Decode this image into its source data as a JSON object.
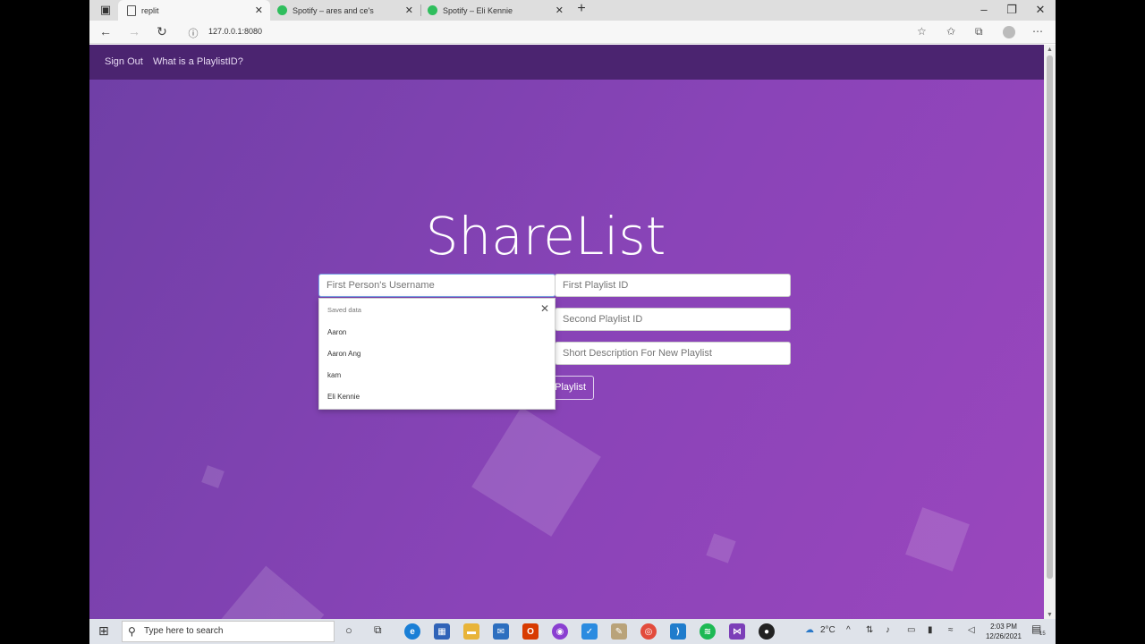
{
  "browser": {
    "tabs": [
      {
        "label": "replit",
        "icon": "page-icon"
      },
      {
        "label": "Spotify – ares and ce's",
        "icon": "spotify-icon"
      },
      {
        "label": "Spotify – Eli Kennie",
        "icon": "spotify-icon"
      }
    ],
    "new_tab_label": "+",
    "url": "127.0.0.1:8080"
  },
  "nav": {
    "sign_out": "Sign Out",
    "what_is": "What is a PlaylistID?"
  },
  "main": {
    "title": "ShareList",
    "fields": {
      "first_username": {
        "placeholder": "First Person's Username"
      },
      "first_playlist": {
        "placeholder": "First Playlist ID"
      },
      "second_playlist": {
        "placeholder": "Second Playlist ID"
      },
      "description": {
        "placeholder": "Short Description For New Playlist"
      }
    },
    "submit_label": "Playlist"
  },
  "autofill": {
    "header": "Saved data",
    "items": [
      "Aaron",
      "Aaron Ang",
      "kam",
      "Eli Kennie"
    ]
  },
  "taskbar": {
    "search_placeholder": "Type here to search",
    "weather": "2°C",
    "time": "2:03 PM",
    "date": "12/26/2021",
    "notifications": "15"
  },
  "colors": {
    "page_gradient_start": "#6f3fa6",
    "page_gradient_end": "#9a46bd",
    "nav_bar": "#4b2470",
    "spotify_green": "#2fbe5d"
  }
}
